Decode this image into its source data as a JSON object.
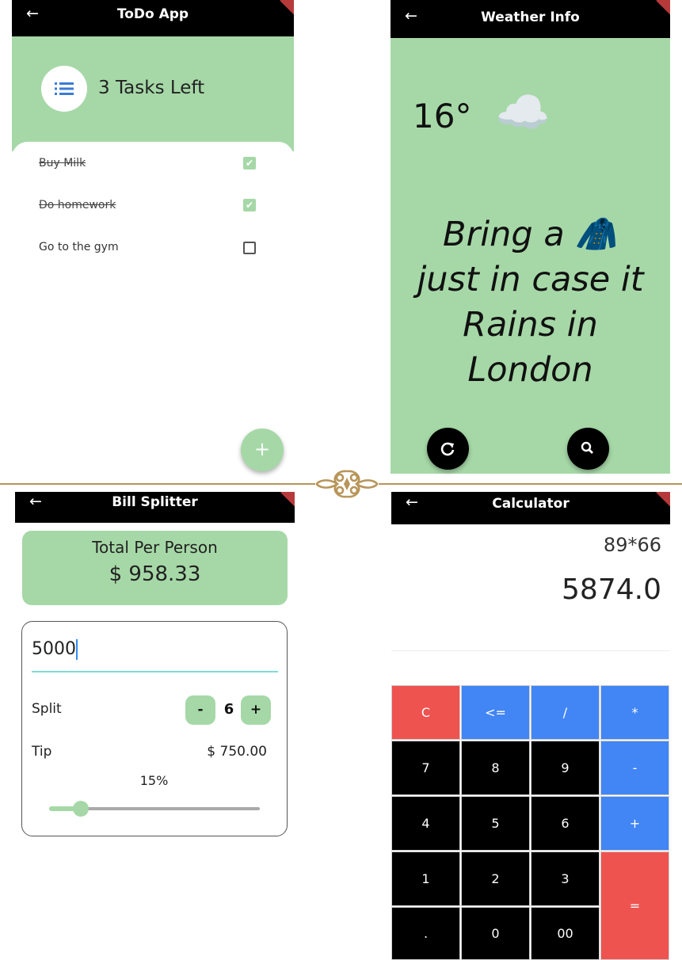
{
  "todo": {
    "title": "ToDo App",
    "tasks_left": "3 Tasks Left",
    "tasks": [
      {
        "label": "Buy Milk",
        "done": true
      },
      {
        "label": "Do homework",
        "done": true
      },
      {
        "label": "Go to the gym",
        "done": false
      }
    ],
    "fab_label": "+"
  },
  "weather": {
    "title": "Weather Info",
    "temperature": "16°",
    "icon": "☁️",
    "message_line1": "Bring a 🧥",
    "message_line2": "just in case it",
    "message_line3": "Rains in",
    "message_line4": "London"
  },
  "bill": {
    "title": "Bill Splitter",
    "total_label": "Total Per Person",
    "total_value": "$ 958.33",
    "amount_input": "5000",
    "split_label": "Split",
    "minus_label": "-",
    "split_count": "6",
    "plus_label": "+",
    "tip_label": "Tip",
    "tip_value": "$ 750.00",
    "tip_percent": "15%",
    "slider_fraction": 0.15
  },
  "calc": {
    "title": "Calculator",
    "expression": "89*66",
    "result": "5874.0",
    "keys": {
      "c": "C",
      "back": "<=",
      "div": "/",
      "mul": "*",
      "n7": "7",
      "n8": "8",
      "n9": "9",
      "minus": "-",
      "n4": "4",
      "n5": "5",
      "n6": "6",
      "plus": "+",
      "n1": "1",
      "n2": "2",
      "n3": "3",
      "eq": "=",
      "dot": ".",
      "n0": "0",
      "n00": "00"
    }
  },
  "colors": {
    "accent_green": "#a6d8a7",
    "calc_blue": "#4285f4",
    "calc_red": "#ef5350",
    "divider_gold": "#b8955a"
  }
}
